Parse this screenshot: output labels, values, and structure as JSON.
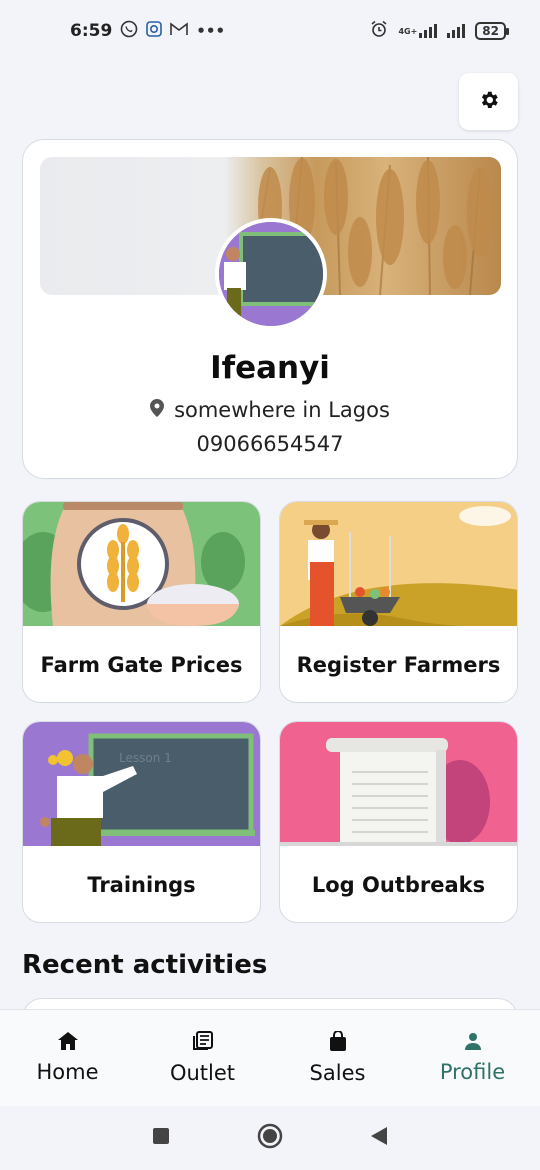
{
  "status_bar": {
    "time": "6:59",
    "network": "4G+",
    "battery": "82"
  },
  "profile": {
    "name": "Ifeanyi",
    "location": "somewhere in Lagos",
    "phone": "09066654547"
  },
  "tiles": [
    {
      "label": "Farm Gate Prices",
      "icon": "wheat-sack-illustration"
    },
    {
      "label": "Register Farmers",
      "icon": "farmer-wheelbarrow-illustration"
    },
    {
      "label": "Trainings",
      "icon": "teacher-chalkboard-illustration"
    },
    {
      "label": "Log Outbreaks",
      "icon": "notepad-illustration"
    }
  ],
  "recent_activities_title": "Recent activities",
  "bottom_nav": [
    {
      "label": "Home",
      "icon": "home-icon",
      "active": false
    },
    {
      "label": "Outlet",
      "icon": "newspaper-icon",
      "active": false
    },
    {
      "label": "Sales",
      "icon": "shopping-bag-icon",
      "active": false
    },
    {
      "label": "Profile",
      "icon": "person-icon",
      "active": true
    }
  ],
  "colors": {
    "accent": "#2f7268",
    "background": "#f2f4fa",
    "farm_tile_bg": "#7cc27a",
    "register_tile_bg": "#f4cf85",
    "trainings_tile_bg": "#9a78d1",
    "outbreaks_tile_bg": "#f0628f"
  }
}
